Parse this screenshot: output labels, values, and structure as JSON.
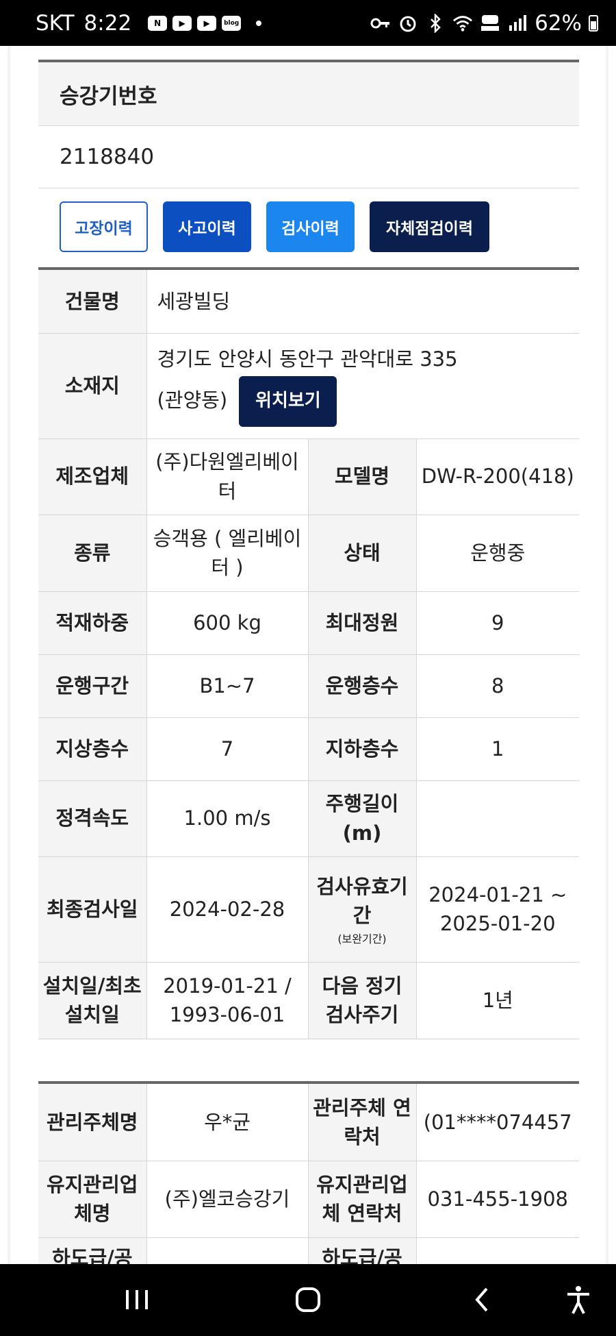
{
  "status_bar": {
    "carrier": "SKT",
    "time": "8:22",
    "notification_icons": [
      "naver-icon",
      "youtube-icon",
      "youtube-icon",
      "blog-icon"
    ],
    "notif_labels": [
      "N",
      "▶",
      "▶",
      "blog"
    ],
    "system_icons": [
      "key-icon",
      "alarm-icon",
      "bluetooth-icon",
      "wifi-icon",
      "hd-voice-icon",
      "signal-icon"
    ],
    "battery": "62%"
  },
  "elevator": {
    "header": "승강기번호",
    "number": "2118840"
  },
  "buttons": {
    "fault": "고장이력",
    "accident": "사고이력",
    "inspect": "검사이력",
    "self_check": "자체점검이력"
  },
  "info": {
    "building_label": "건물명",
    "building_value": "세광빌딩",
    "location_label": "소재지",
    "location_line1": "경기도 안양시 동안구 관악대로 335",
    "location_line2": "(관양동)",
    "location_button": "위치보기",
    "maker_label": "제조업체",
    "maker_value": "(주)다원엘리베이터",
    "model_label": "모델명",
    "model_value": "DW-R-200(418)",
    "type_label": "종류",
    "type_value": "승객용 ( 엘리베이터 )",
    "state_label": "상태",
    "state_value": "운행중",
    "load_label": "적재하중",
    "load_value": "600 kg",
    "capacity_label": "최대정원",
    "capacity_value": "9",
    "section_label": "운행구간",
    "section_value": "B1~7",
    "floors_label": "운행층수",
    "floors_value": "8",
    "above_label": "지상층수",
    "above_value": "7",
    "below_label": "지하층수",
    "below_value": "1",
    "speed_label": "정격속도",
    "speed_value": "1.00 m/s",
    "travel_label": "주행길이(m)",
    "travel_value": "",
    "last_inspect_label": "최종검사일",
    "last_inspect_value": "2024-02-28",
    "valid_label": "검사유효기간",
    "valid_note": "(보완기간)",
    "valid_value": "2024-01-21 ~ 2025-01-20",
    "install_label": "설치일/최초설치일",
    "install_value": "2019-01-21 / 1993-06-01",
    "next_label": "다음 정기 검사주기",
    "next_value": "1년"
  },
  "management": {
    "owner_label": "관리주체명",
    "owner_value": "우*균",
    "owner_contact_label": "관리주체 연락처",
    "owner_contact_value": "(01****074457",
    "maint_label": "유지관리업체명",
    "maint_value": "(주)엘코승강기",
    "maint_contact_label": "유지관리업체 연락처",
    "maint_contact_value": "031-455-1908",
    "sub_label_1": "하도급/공",
    "sub_label_2": "하도급/공"
  },
  "nav": [
    "recent-apps-icon",
    "home-icon",
    "back-icon",
    "accessibility-icon"
  ]
}
